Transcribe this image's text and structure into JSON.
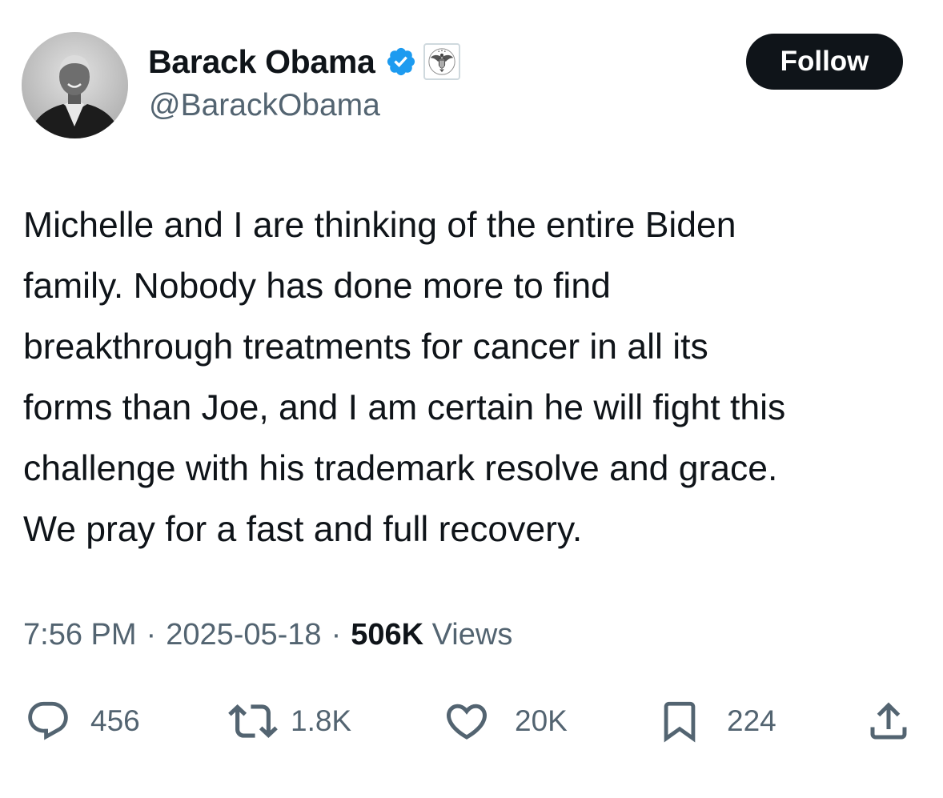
{
  "author": {
    "display_name": "Barack Obama",
    "handle": "@BarackObama",
    "verified_icon": "verified-badge-icon",
    "affiliation_icon": "government-seal-icon",
    "avatar": "profile-avatar"
  },
  "follow_button": {
    "label": "Follow"
  },
  "tweet": {
    "lines": [
      "Michelle and I are thinking of the entire Biden",
      "family. Nobody has done more to find",
      "breakthrough treatments for cancer in all its",
      "forms than Joe, and I am certain he will fight this",
      "challenge with his trademark resolve and grace.",
      "We pray for a fast and full recovery."
    ]
  },
  "meta": {
    "time": "7:56 PM",
    "separator": "·",
    "date": "2025-05-18",
    "views_count": "506K",
    "views_label": "Views"
  },
  "actions": {
    "replies": {
      "icon": "reply-icon",
      "count": "456"
    },
    "reposts": {
      "icon": "repost-icon",
      "count": "1.8K"
    },
    "likes": {
      "icon": "heart-icon",
      "count": "20K"
    },
    "bookmarks": {
      "icon": "bookmark-icon",
      "count": "224"
    },
    "share": {
      "icon": "share-icon"
    }
  },
  "colors": {
    "text_primary": "#0f1419",
    "text_secondary": "#536471",
    "verified_blue": "#1d9bf0",
    "button_bg": "#0f1419",
    "button_text": "#ffffff",
    "background": "#ffffff"
  }
}
